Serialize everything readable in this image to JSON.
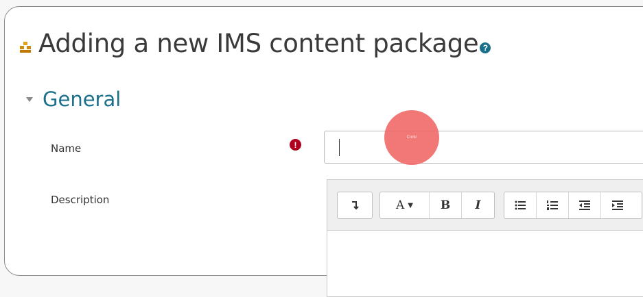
{
  "page": {
    "title": "Adding a new IMS content package",
    "help_icon": "question-circle-icon",
    "title_icon": "content-package-icon"
  },
  "section": {
    "title": "General",
    "toggle_icon": "chevron-down-icon"
  },
  "form": {
    "name_label": "Name",
    "name_value": "",
    "required_icon": "exclamation-circle-icon",
    "description_label": "Description"
  },
  "click_marker": {
    "text": "Contr"
  },
  "editor_toolbar": {
    "collapse_icon": "toolbar-toggle-icon",
    "font_style_label": "A",
    "bold_label": "B",
    "italic_label": "I",
    "unordered_list_icon": "unordered-list-icon",
    "ordered_list_icon": "ordered-list-icon",
    "outdent_icon": "outdent-icon",
    "indent_icon": "indent-icon"
  },
  "colors": {
    "accent": "#1a6f8a",
    "required": "#b00020",
    "click_marker": "#f05f5f"
  }
}
